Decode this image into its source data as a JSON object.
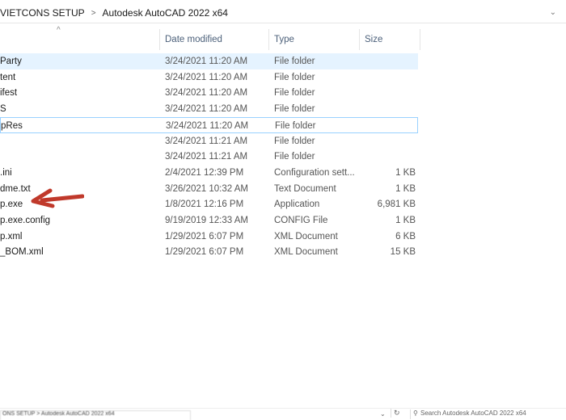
{
  "address": {
    "crumbs": [
      "VIETCONS SETUP",
      "Autodesk AutoCAD 2022 x64"
    ],
    "separator": ">",
    "dropdown": "⌄"
  },
  "columns": {
    "name_sort": "^",
    "date": "Date modified",
    "type": "Type",
    "size": "Size"
  },
  "rows": [
    {
      "name": "Party",
      "date": "3/24/2021 11:20 AM",
      "type": "File folder",
      "size": ""
    },
    {
      "name": "tent",
      "date": "3/24/2021 11:20 AM",
      "type": "File folder",
      "size": ""
    },
    {
      "name": "ifest",
      "date": "3/24/2021 11:20 AM",
      "type": "File folder",
      "size": ""
    },
    {
      "name": "S",
      "date": "3/24/2021 11:20 AM",
      "type": "File folder",
      "size": ""
    },
    {
      "name": "pRes",
      "date": "3/24/2021 11:20 AM",
      "type": "File folder",
      "size": ""
    },
    {
      "name": "",
      "date": "3/24/2021 11:21 AM",
      "type": "File folder",
      "size": ""
    },
    {
      "name": "",
      "date": "3/24/2021 11:21 AM",
      "type": "File folder",
      "size": ""
    },
    {
      "name": ".ini",
      "date": "2/4/2021 12:39 PM",
      "type": "Configuration sett...",
      "size": "1 KB"
    },
    {
      "name": "dme.txt",
      "date": "3/26/2021 10:32 AM",
      "type": "Text Document",
      "size": "1 KB"
    },
    {
      "name": "p.exe",
      "date": "1/8/2021 12:16 PM",
      "type": "Application",
      "size": "6,981 KB"
    },
    {
      "name": "p.exe.config",
      "date": "9/19/2019 12:33 AM",
      "type": "CONFIG File",
      "size": "1 KB"
    },
    {
      "name": "p.xml",
      "date": "1/29/2021 6:07 PM",
      "type": "XML Document",
      "size": "6 KB"
    },
    {
      "name": "_BOM.xml",
      "date": "1/29/2021 6:07 PM",
      "type": "XML Document",
      "size": "15 KB"
    }
  ],
  "annotation": {
    "arrow_color": "#c0392b"
  },
  "bottom": {
    "address": "ONS SETUP  >  Autodesk AutoCAD 2022 x64",
    "search_placeholder": "Search Autodesk AutoCAD 2022 x64",
    "search_icon": "⚲",
    "refresh_icon": "↻",
    "chevron": "⌄"
  }
}
